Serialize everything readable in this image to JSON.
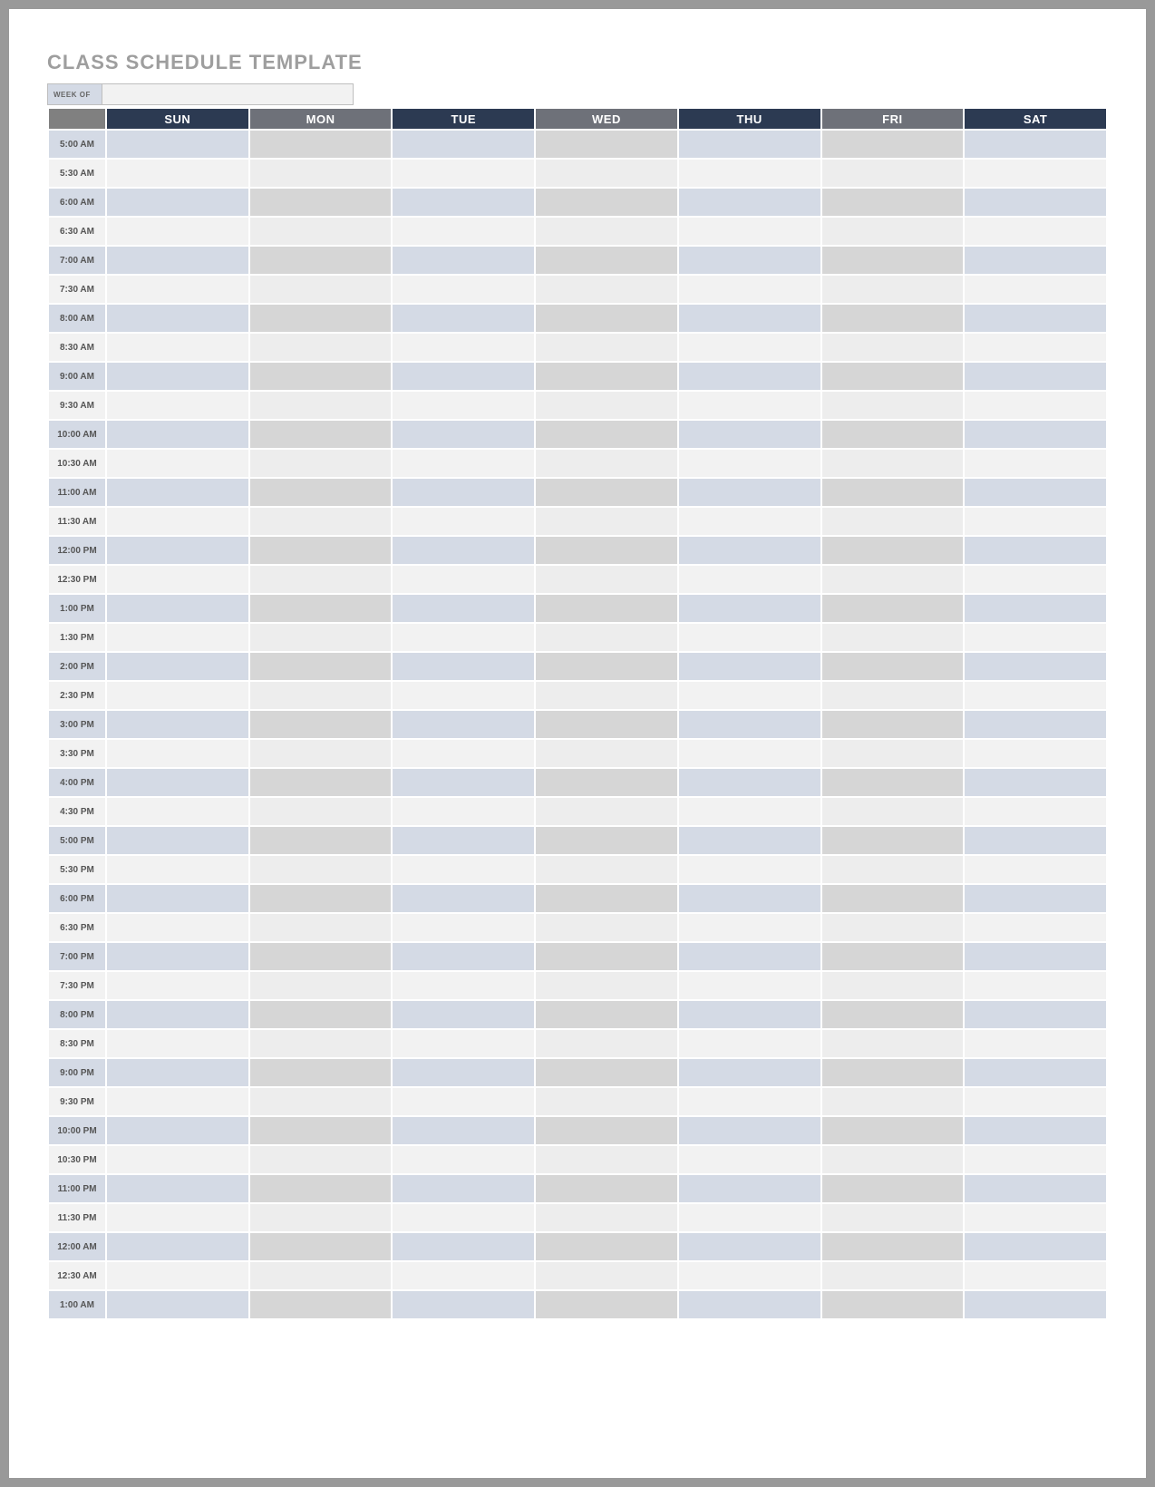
{
  "title": "CLASS SCHEDULE TEMPLATE",
  "weekof": {
    "label": "WEEK OF",
    "value": ""
  },
  "days": [
    "SUN",
    "MON",
    "TUE",
    "WED",
    "THU",
    "FRI",
    "SAT"
  ],
  "times": [
    "5:00 AM",
    "5:30 AM",
    "6:00 AM",
    "6:30 AM",
    "7:00 AM",
    "7:30 AM",
    "8:00 AM",
    "8:30 AM",
    "9:00 AM",
    "9:30 AM",
    "10:00 AM",
    "10:30 AM",
    "11:00 AM",
    "11:30 AM",
    "12:00 PM",
    "12:30 PM",
    "1:00 PM",
    "1:30 PM",
    "2:00 PM",
    "2:30 PM",
    "3:00 PM",
    "3:30 PM",
    "4:00 PM",
    "4:30 PM",
    "5:00 PM",
    "5:30 PM",
    "6:00 PM",
    "6:30 PM",
    "7:00 PM",
    "7:30 PM",
    "8:00 PM",
    "8:30 PM",
    "9:00 PM",
    "9:30 PM",
    "10:00 PM",
    "10:30 PM",
    "11:00 PM",
    "11:30 PM",
    "12:00 AM",
    "12:30 AM",
    "1:00 AM"
  ],
  "cells": {}
}
